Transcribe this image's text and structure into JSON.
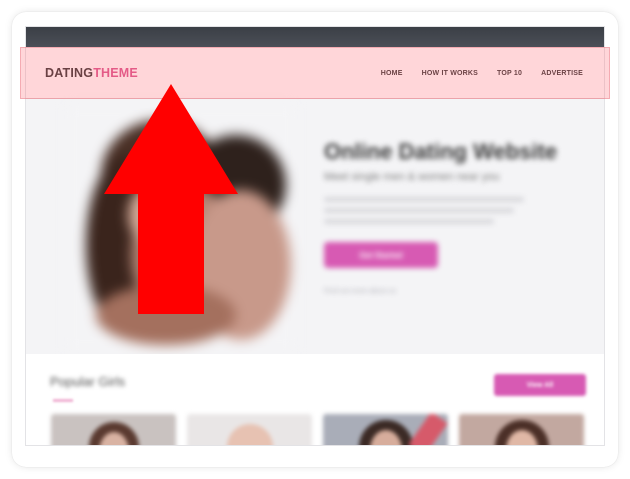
{
  "site": {
    "logo_part1": "DATING",
    "logo_part2": "THEME"
  },
  "nav": {
    "items": [
      {
        "label": "HOME",
        "name": "nav-home"
      },
      {
        "label": "HOW IT WORKS",
        "name": "nav-how-it-works"
      },
      {
        "label": "TOP 10",
        "name": "nav-top-10"
      },
      {
        "label": "ADVERTISE",
        "name": "nav-advertise"
      }
    ]
  },
  "hero": {
    "title": "Online Dating Website",
    "subtitle": "Meet single men & women near you",
    "cta_label": "Get Started",
    "note": "Find out more about us"
  },
  "popular": {
    "title": "Popular Girls",
    "button_label": "View All"
  },
  "colors": {
    "brand": "#d94f8a",
    "accent": "#d75ab3",
    "highlight": "rgba(255,120,130,0.30)",
    "arrow": "#ff0000"
  },
  "icons": {
    "annotation": "up-arrow-icon"
  }
}
